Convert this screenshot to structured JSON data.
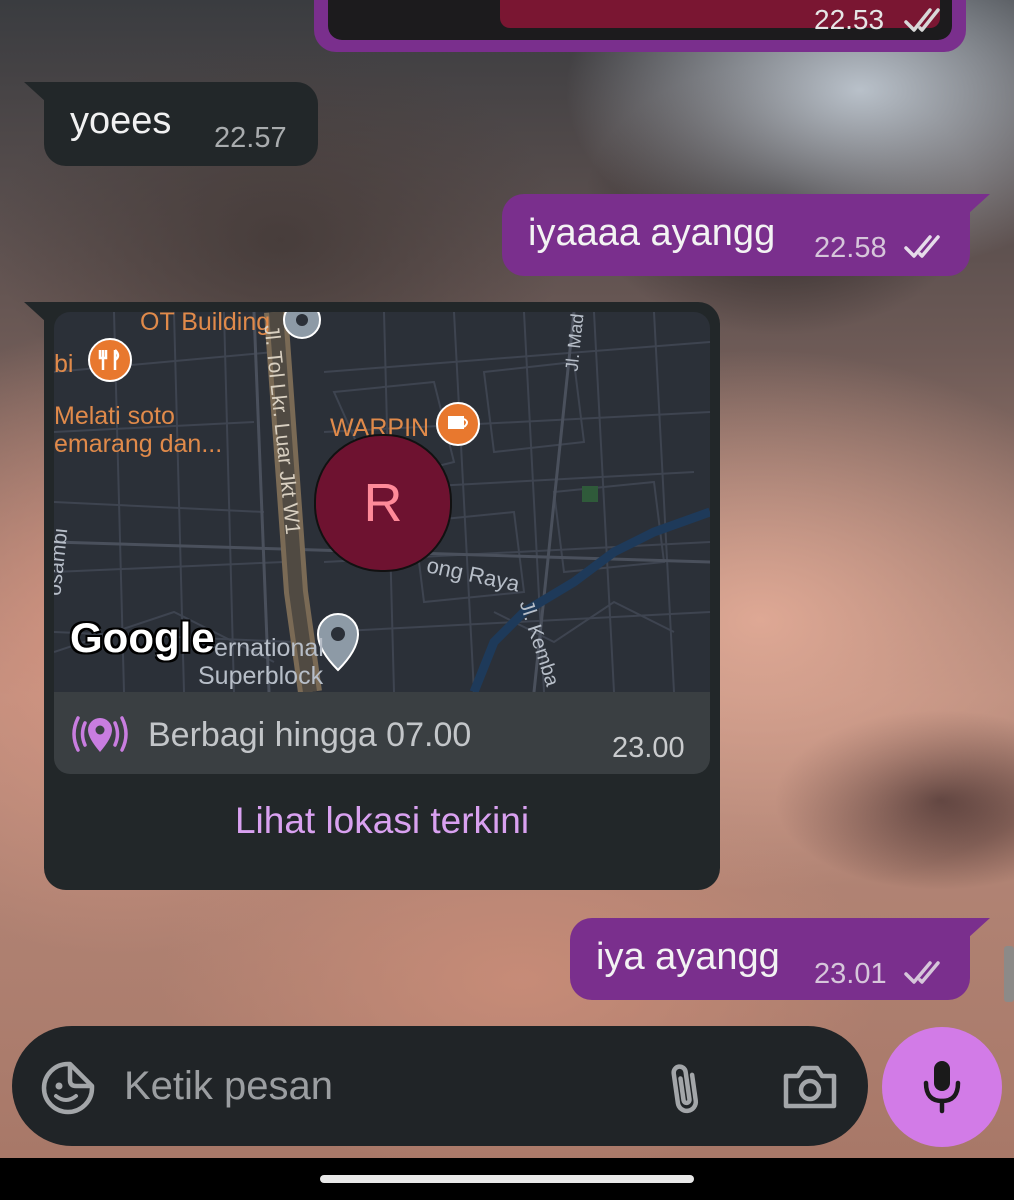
{
  "colors": {
    "outgoing_bubble": "#7a2f8d",
    "incoming_bubble": "#222729",
    "accent": "#d27be7",
    "link": "#d9a1f0",
    "avatar_bg": "#6e1230",
    "avatar_text": "#ff8a99"
  },
  "messages": {
    "top_partial": {
      "time": "22.53"
    },
    "m1": {
      "text": "yoees",
      "time": "22.57"
    },
    "m2": {
      "text": "iyaaaa ayangg",
      "time": "22.58"
    },
    "m4": {
      "text": "iya ayangg",
      "time": "23.01"
    }
  },
  "location": {
    "avatar_letter": "R",
    "google_logo": "Google",
    "map_labels": {
      "building": "OT Building",
      "bi": "bi",
      "melati1": "Melati soto",
      "melati2": "emarang dan...",
      "warpin": "WARPIN",
      "tol": "Jl. Tol Lkr. Luar Jkt W1",
      "raya": "ong Raya",
      "international": "ernational",
      "superblock": "Superblock",
      "kosambi": "osambi",
      "kemba": "Jl. Kemba",
      "mad": "Jl. Mad"
    },
    "share_text": "Berbagi hingga 07.00",
    "time": "23.00",
    "action": "Lihat lokasi terkini"
  },
  "composer": {
    "placeholder": "Ketik pesan",
    "icons": [
      "sticker-icon",
      "attach-icon",
      "camera-icon",
      "mic-icon"
    ]
  }
}
